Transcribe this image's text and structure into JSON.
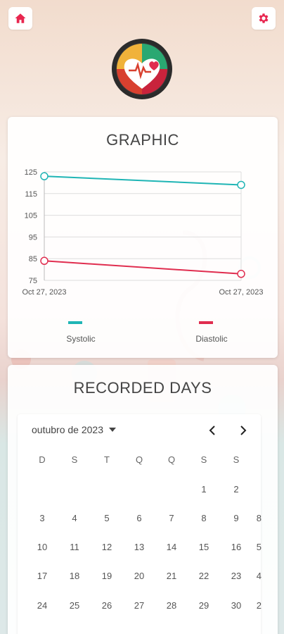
{
  "header": {
    "home_icon": "home-icon",
    "settings_icon": "gear-icon",
    "logo_icon": "heart-pulse-logo"
  },
  "colors": {
    "accent": "#e8264f",
    "systolic": "#1fb5b5",
    "diastolic": "#e02d4f"
  },
  "graphic": {
    "title": "GRAPHIC"
  },
  "chart_data": {
    "type": "line",
    "x": [
      "Oct 27, 2023",
      "Oct 27, 2023"
    ],
    "series": [
      {
        "name": "Systolic",
        "values": [
          123,
          119
        ],
        "color": "#1fb5b5"
      },
      {
        "name": "Diastolic",
        "values": [
          84,
          78
        ],
        "color": "#e02d4f"
      }
    ],
    "y_ticks": [
      125,
      115,
      105,
      95,
      85,
      75
    ],
    "ylim": [
      75,
      125
    ],
    "grid": true,
    "legend": "bottom"
  },
  "recorded_days": {
    "title": "RECORDED DAYS",
    "month_label": "outubro de 2023",
    "weekdays": [
      "D",
      "S",
      "T",
      "Q",
      "Q",
      "S",
      "S"
    ],
    "weeks": [
      [
        "",
        "",
        "",
        "",
        "",
        "1",
        "2"
      ],
      [
        "3",
        "4",
        "5",
        "6",
        "7",
        "8",
        "9"
      ],
      [
        "10",
        "11",
        "12",
        "13",
        "14",
        "15",
        "16"
      ],
      [
        "17",
        "18",
        "19",
        "20",
        "21",
        "22",
        "23"
      ],
      [
        "24",
        "25",
        "26",
        "27",
        "28",
        "29",
        "30"
      ]
    ],
    "edge_right": [
      "",
      "8",
      "5",
      "4",
      "2"
    ],
    "prev_icon": "chevron-left-icon",
    "next_icon": "chevron-right-icon"
  }
}
